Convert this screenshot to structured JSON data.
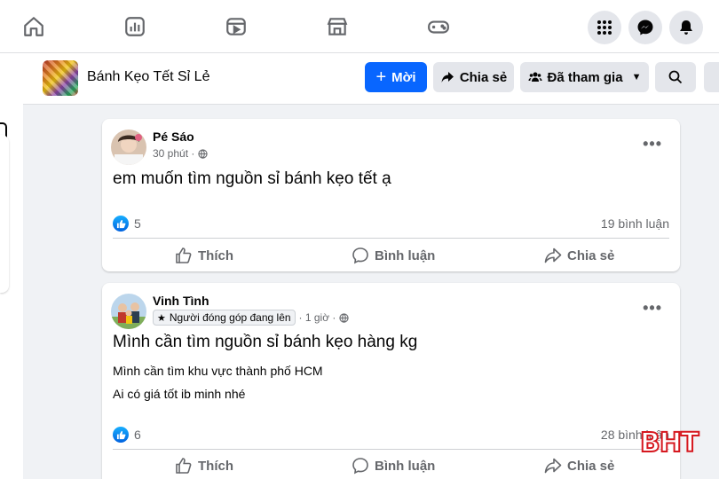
{
  "group": {
    "name": "Bánh Kẹo Tết Sỉ Lẻ"
  },
  "header_buttons": {
    "new": "Mời",
    "share": "Chia sẻ",
    "joined": "Đã tham gia"
  },
  "colors": {
    "primary": "#0866ff",
    "watermark": "#d6181f"
  },
  "posts": [
    {
      "author": "Pé Sáo",
      "time": "30 phút ·",
      "text": "em muốn tìm nguồn sỉ bánh kẹo tết ạ",
      "body": [],
      "likes": "5",
      "comments": "19 bình luận"
    },
    {
      "author": "Vinh Tình",
      "badge": "Người đóng góp đang lên",
      "time": "· 1 giờ ·",
      "text": "Mình cần tìm nguồn sỉ bánh kẹo hàng kg",
      "body": [
        "Mình cần tìm khu vực thành phố HCM",
        "Ai có giá tốt ib minh nhé"
      ],
      "likes": "6",
      "comments": "28 bình luận"
    }
  ],
  "actions": {
    "like": "Thích",
    "comment": "Bình luận",
    "share": "Chia sẻ"
  },
  "watermark": "BHT",
  "icons": [
    "home-icon",
    "pages-icon",
    "video-icon",
    "marketplace-icon",
    "gaming-icon",
    "menu-grid-icon",
    "messenger-icon",
    "bell-icon",
    "search-icon",
    "globe-icon",
    "like-icon",
    "comment-icon",
    "share-icon"
  ]
}
